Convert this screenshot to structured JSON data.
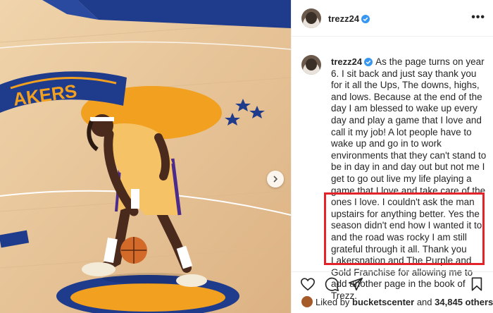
{
  "post": {
    "username": "trezz24",
    "more_label": "•••",
    "caption_text": "As the page turns on year 6. I sit back and just say thank you for it all the Ups, The downs, highs, and lows. Because at the end of the day I am blessed to wake up every day and play a game that I love and call it my job! A lot people have to wake up and go in to work environments that they can't stand to be in day in and day out but not me I get to go out live my life playing a game that I love and take care of the ones I love. I couldn't ask the man upstairs for anything better. Yes the season didn't end how I wanted it to and the road was rocky I am still grateful through it all. Thank you Lakersnation and The Purple and Gold Franchise for allowing me to add another page in the book of Trezz."
  },
  "likes": {
    "prefix": "Liked by",
    "user": "bucketscenter",
    "joiner": "and",
    "count": "34,845 others"
  },
  "icons": [
    "verified-badge-icon",
    "heart-icon",
    "comment-icon",
    "share-icon",
    "bookmark-icon",
    "chevron-right-icon",
    "more-options-icon"
  ],
  "colors": {
    "verified": "#3897f0",
    "highlight": "#e2232a",
    "text": "#262626"
  }
}
